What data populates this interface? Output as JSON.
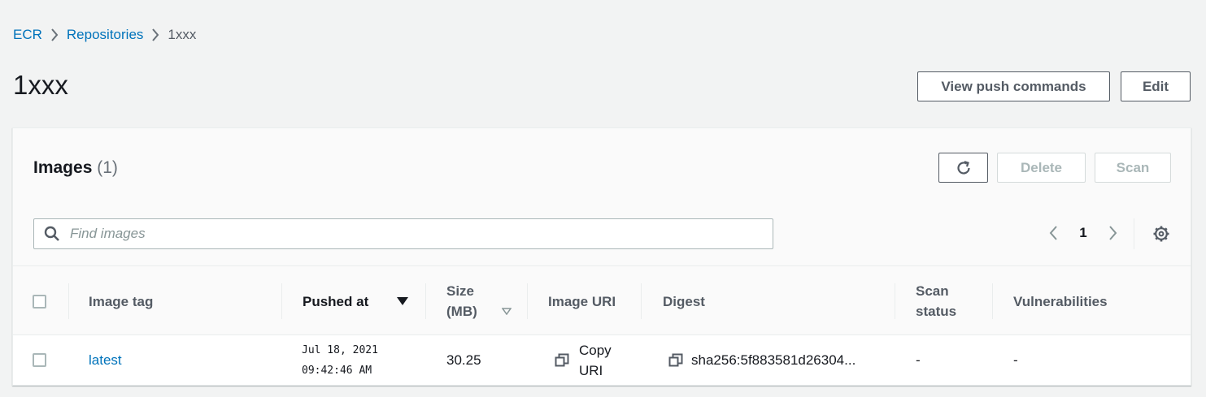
{
  "breadcrumb": {
    "items": [
      "ECR",
      "Repositories"
    ],
    "current": "1xxx"
  },
  "page": {
    "title": "1xxx",
    "view_push_commands_label": "View push commands",
    "edit_label": "Edit"
  },
  "panel": {
    "title": "Images",
    "count": "(1)",
    "delete_label": "Delete",
    "scan_label": "Scan",
    "search_placeholder": "Find images",
    "page_number": "1"
  },
  "table": {
    "columns": {
      "image_tag": "Image tag",
      "pushed_at": "Pushed at",
      "size_line1": "Size",
      "size_line2": "(MB)",
      "image_uri": "Image URI",
      "digest": "Digest",
      "scan_status_line1": "Scan",
      "scan_status_line2": "status",
      "vulnerabilities": "Vulnerabilities"
    },
    "rows": [
      {
        "image_tag": "latest",
        "pushed_date": "Jul 18, 2021",
        "pushed_time": "09:42:46 AM",
        "size": "30.25",
        "uri_line1": "Copy",
        "uri_line2": "URI",
        "digest": "sha256:5f883581d26304...",
        "scan_status": "-",
        "vulnerabilities": "-"
      }
    ]
  },
  "colors": {
    "link": "#0073bb",
    "background": "#f2f3f3",
    "border": "#545b64",
    "disabled": "#aab7b8"
  }
}
